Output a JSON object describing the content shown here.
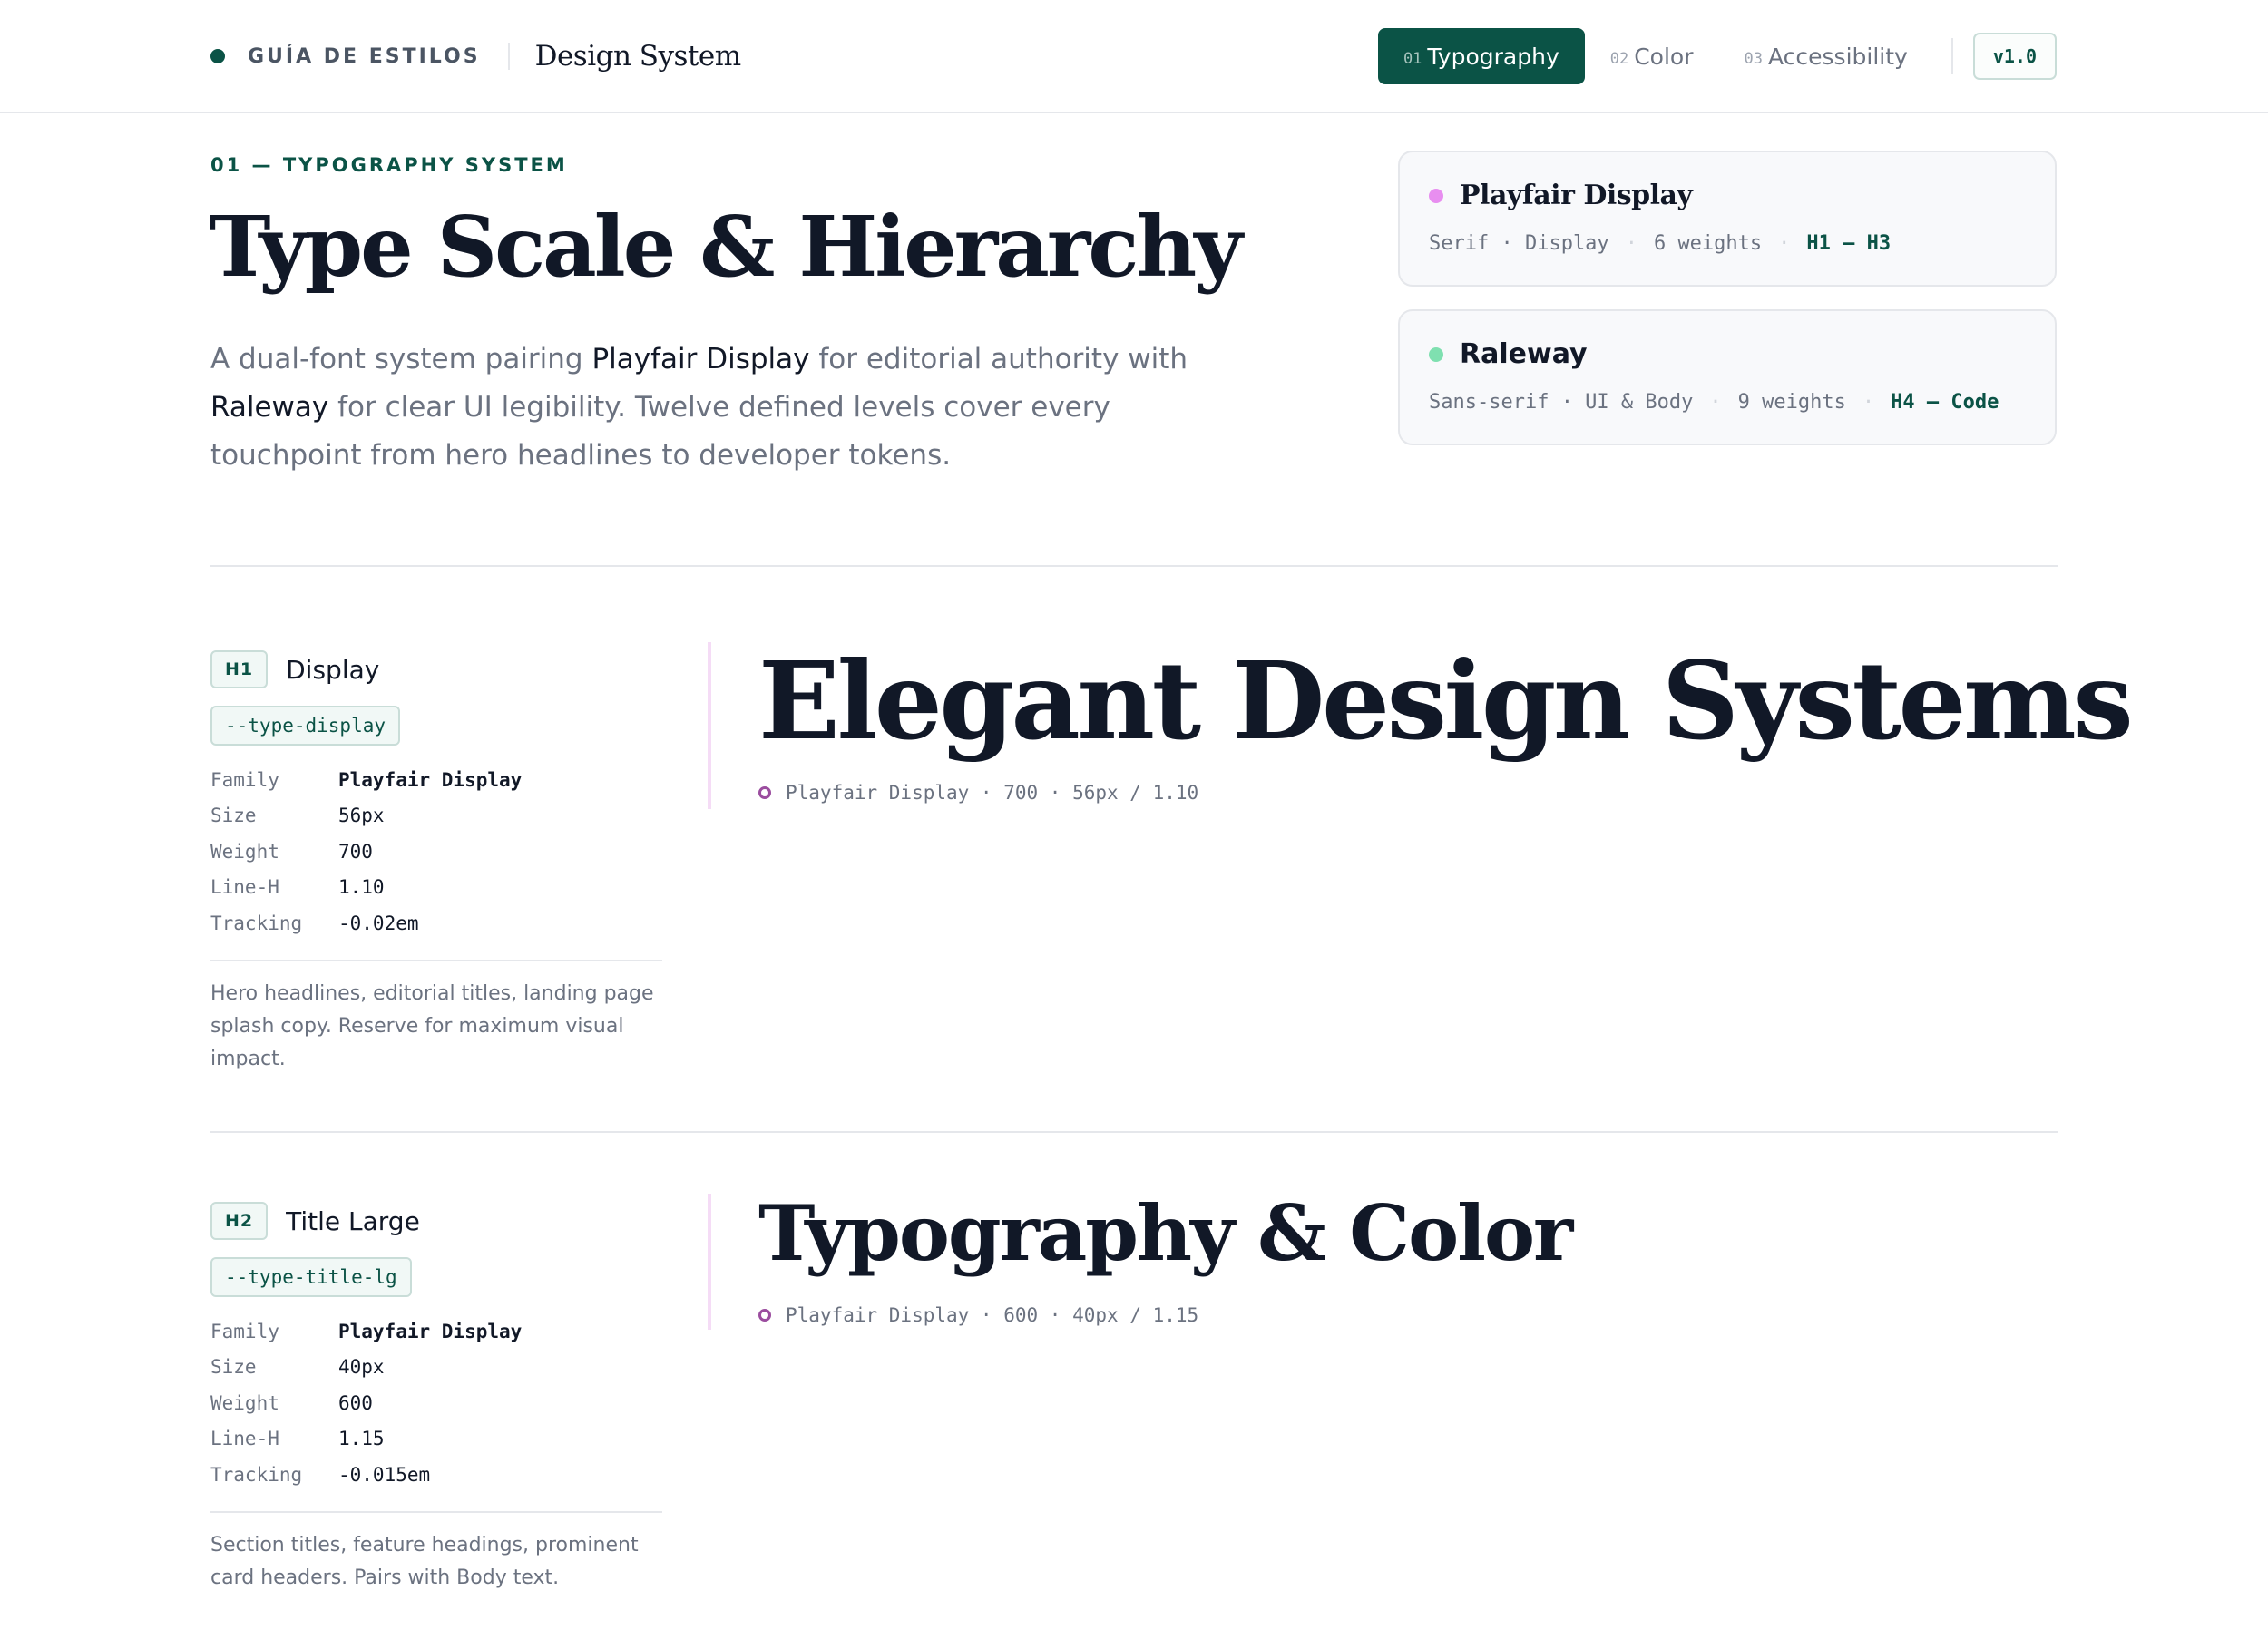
{
  "header": {
    "brand_label": "GUÍA DE ESTILOS",
    "brand_title": "Design System",
    "tabs": [
      {
        "num": "01",
        "label": "Typography"
      },
      {
        "num": "02",
        "label": "Color"
      },
      {
        "num": "03",
        "label": "Accessibility"
      }
    ],
    "active_tab": "Typography",
    "version": "v1.0"
  },
  "intro": {
    "eyebrow": "01 — TYPOGRAPHY SYSTEM",
    "title": "Type Scale & Hierarchy",
    "desc_1": "A dual-font system pairing ",
    "desc_font_1": "Playfair Display",
    "desc_2": " for editorial authority with ",
    "desc_font_2": "Raleway",
    "desc_3": " for clear UI legibility. Twelve defined levels cover every touchpoint from hero headlines to developer tokens."
  },
  "font_cards": [
    {
      "name": "Playfair Display",
      "classification": "Serif · Display",
      "weights": "6 weights",
      "range": "H1 – H3",
      "dot_color": "#e88ef0"
    },
    {
      "name": "Raleway",
      "classification": "Sans-serif · UI & Body",
      "weights": "9 weights",
      "range": "H4 – Code",
      "dot_color": "#7fe0b0"
    }
  ],
  "levels": [
    {
      "level": "H1",
      "name": "Display",
      "token": "--type-display",
      "props": [
        {
          "key": "Family",
          "value": "Playfair Display"
        },
        {
          "key": "Size",
          "value": "56px"
        },
        {
          "key": "Weight",
          "value": "700"
        },
        {
          "key": "Line-H",
          "value": "1.10"
        },
        {
          "key": "Tracking",
          "value": "-0.02em"
        }
      ],
      "usage": "Hero headlines, editorial titles, landing page splash copy. Reserve for maximum visual impact.",
      "sample": "Elegant Design Systems",
      "caption": "Playfair Display · 700 · 56px / 1.10"
    },
    {
      "level": "H2",
      "name": "Title Large",
      "token": "--type-title-lg",
      "props": [
        {
          "key": "Family",
          "value": "Playfair Display"
        },
        {
          "key": "Size",
          "value": "40px"
        },
        {
          "key": "Weight",
          "value": "600"
        },
        {
          "key": "Line-H",
          "value": "1.15"
        },
        {
          "key": "Tracking",
          "value": "-0.015em"
        }
      ],
      "usage": "Section titles, feature headings, prominent card headers. Pairs with Body text.",
      "sample": "Typography & Color",
      "caption": "Playfair Display · 600 · 40px / 1.15"
    }
  ],
  "colors": {
    "brand": "#0b5346",
    "sample_accent": "#9b4d9f"
  }
}
